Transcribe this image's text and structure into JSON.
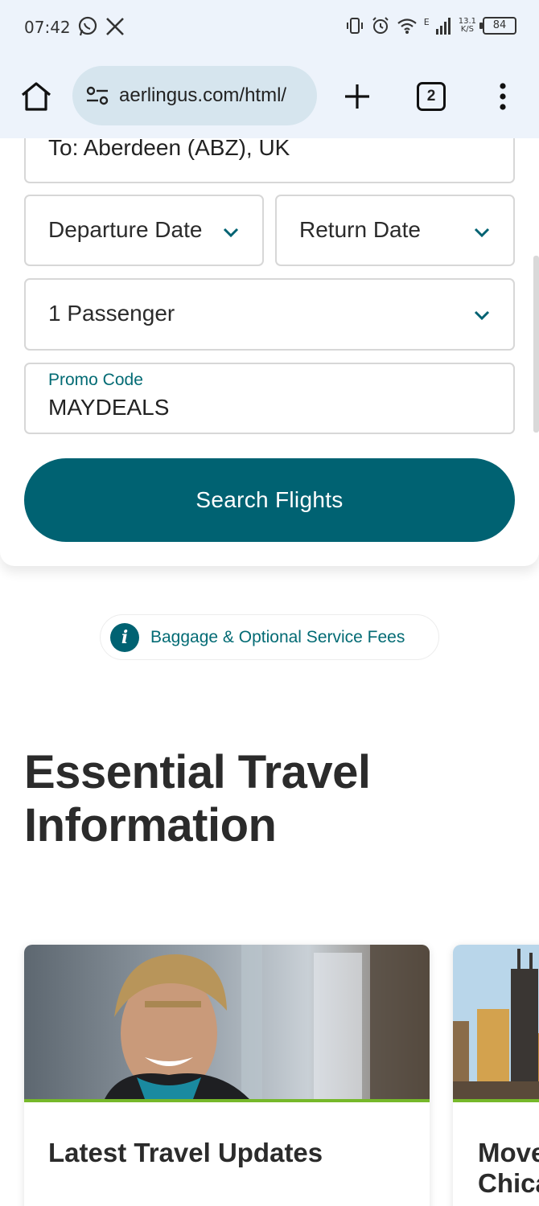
{
  "status_bar": {
    "time": "07:42",
    "network_label": "E",
    "speed": "13.1",
    "speed_unit": "K/S",
    "battery": "84"
  },
  "browser": {
    "url": "aerlingus.com/html/",
    "tab_count": "2"
  },
  "booking": {
    "to_field": "To: Aberdeen (ABZ), UK",
    "departure_date": "Departure Date",
    "return_date": "Return Date",
    "passengers": "1 Passenger",
    "promo_label": "Promo Code",
    "promo_value": "MAYDEALS",
    "search_button": "Search Flights"
  },
  "baggage_link": "Baggage & Optional Service Fees",
  "section": {
    "title_line1": "Essential Travel",
    "title_line2": "Information"
  },
  "cards": [
    {
      "title": "Latest Travel Updates"
    },
    {
      "title_line1": "Move",
      "title_line2": "Chica"
    }
  ],
  "colors": {
    "brand_teal": "#006272",
    "accent_green": "#76b82a",
    "link_teal": "#036b74"
  }
}
